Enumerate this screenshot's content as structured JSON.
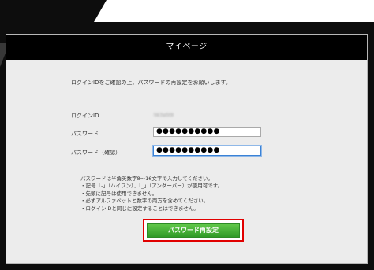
{
  "page": {
    "title": "マイページ",
    "intro_text": "ログインIDをご確認の上、パスワードの再設定をお願いします。"
  },
  "form": {
    "login_id_label": "ログインID",
    "login_id_value": "hk3a5t9",
    "password_label": "パスワード",
    "password_value": "●●●●●●●●●●",
    "password_confirm_label": "パスワード（確認）",
    "password_confirm_value": "●●●●●●●●●●"
  },
  "notes": [
    "パスワードは半角英数字8～16文字で入力してください。",
    "・記号「-」（ハイフン）、「_」（アンダーバー）が使用可です。",
    "・先頭に記号は使用できません。",
    "・必ずアルファベットと数字の両方を含めてください。",
    "・ログインIDと同じに設定することはできません。"
  ],
  "actions": {
    "submit_label": "パスワード再設定"
  },
  "colors": {
    "header_bg": "#000000",
    "panel_bg": "#ececec",
    "button_green": "#3fae33",
    "highlight_red": "#e10000"
  }
}
